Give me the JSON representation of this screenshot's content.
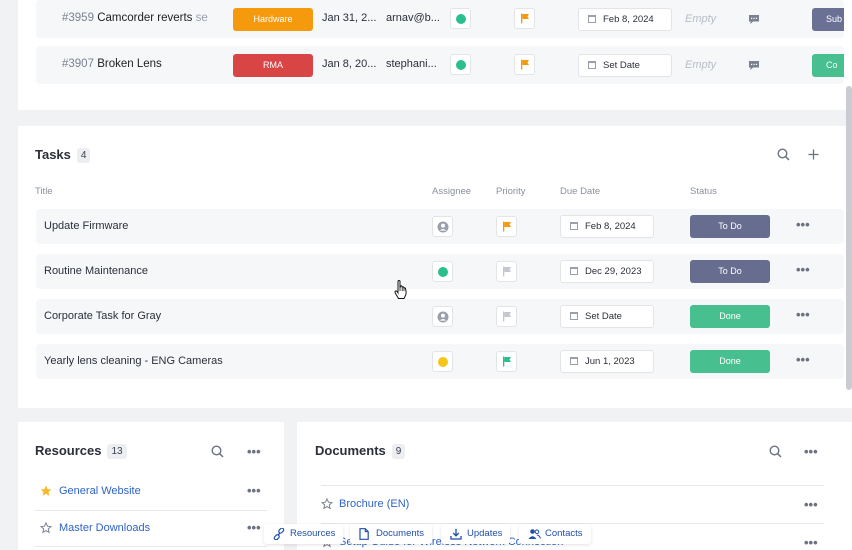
{
  "tickets": [
    {
      "number": "#3959",
      "title": "Camcorder reverts",
      "trail": " se",
      "tag": "Hardware",
      "tag_color": "#f59a0c",
      "date": "Jan 31, 2...",
      "user": "arnav@b...",
      "assignee": "green-avatar-icon",
      "priority": "orange-flag-icon",
      "due_date": "Feb 8, 2024",
      "empty": "Empty",
      "action": "Sub",
      "action_color": "#6b7194"
    },
    {
      "number": "#3907",
      "title": "Broken Lens",
      "trail": "",
      "tag": "RMA",
      "tag_color": "#d94444",
      "date": "Jan 8, 20...",
      "user": "stephani...",
      "assignee": "green-avatar-icon",
      "priority": "orange-flag-icon",
      "due_date": "Set Date",
      "empty": "Empty",
      "action": "Co",
      "action_color": "#48bf8e"
    }
  ],
  "tasks": {
    "title": "Tasks",
    "count": "4",
    "columns": {
      "title": "Title",
      "assignee": "Assignee",
      "priority": "Priority",
      "due_date": "Due Date",
      "status": "Status"
    },
    "rows": [
      {
        "name": "Update Firmware",
        "assignee": "gray-user-icon",
        "priority": "orange-flag-icon",
        "due_date": "Feb 8, 2024",
        "status": "To Do",
        "status_color": "#666d8f"
      },
      {
        "name": "Routine Maintenance",
        "assignee": "green-avatar-icon",
        "priority": "gray-flag-icon",
        "due_date": "Dec 29, 2023",
        "status": "To Do",
        "status_color": "#666d8f"
      },
      {
        "name": "Corporate Task for Gray",
        "assignee": "gray-user-icon",
        "priority": "gray-flag-icon",
        "due_date": "Set Date",
        "status": "Done",
        "status_color": "#48bf8e"
      },
      {
        "name": "Yearly lens cleaning - ENG Cameras",
        "assignee": "yellow-avatar-icon",
        "priority": "green-flag-icon",
        "due_date": "Jun 1, 2023",
        "status": "Done",
        "status_color": "#48bf8e"
      }
    ]
  },
  "resources": {
    "title": "Resources",
    "count": "13",
    "items": [
      {
        "label": "General Website",
        "starred": true
      },
      {
        "label": "Master Downloads",
        "starred": false
      }
    ]
  },
  "documents": {
    "title": "Documents",
    "count": "9",
    "items": [
      {
        "label": "Brochure (EN)"
      },
      {
        "label": "Setup Guide for Wireless Network Connection"
      }
    ]
  },
  "bottom_nav": [
    {
      "label": "Resources",
      "icon": "link-icon"
    },
    {
      "label": "Documents",
      "icon": "document-icon"
    },
    {
      "label": "Updates",
      "icon": "download-icon"
    },
    {
      "label": "Contacts",
      "icon": "contacts-icon"
    }
  ]
}
